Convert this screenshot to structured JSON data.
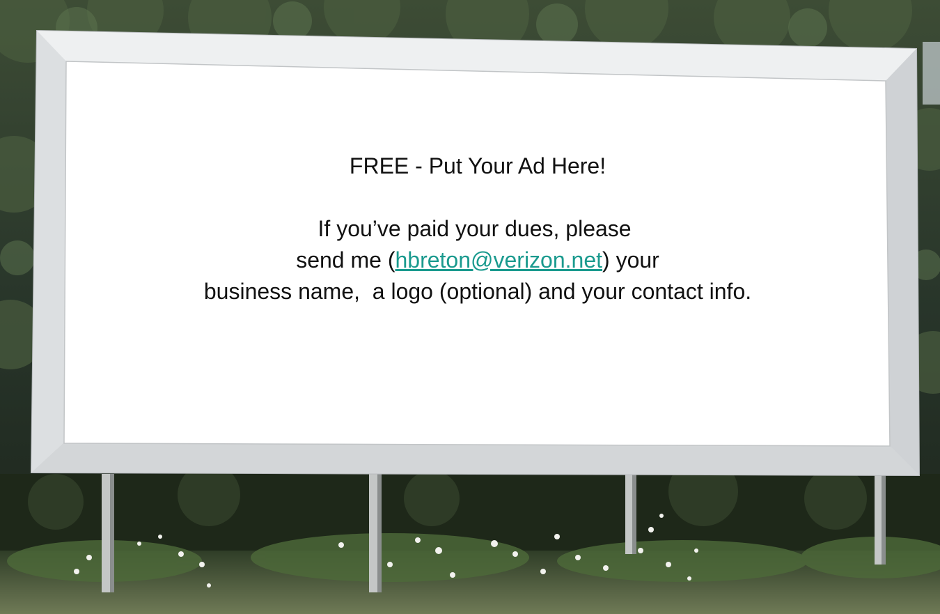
{
  "billboard": {
    "headline": "FREE - Put Your Ad Here!",
    "line1": "If you’ve paid your dues, please ",
    "line2_prefix": "send me (",
    "email": "hbreton@verizon.net",
    "line2_suffix": ") your",
    "line3": "business name,  a logo (optional) and your contact info."
  },
  "colors": {
    "email_link": "#1a9a8e",
    "text": "#111111",
    "board_face": "#ffffff",
    "board_frame": "#e4e6e8"
  }
}
